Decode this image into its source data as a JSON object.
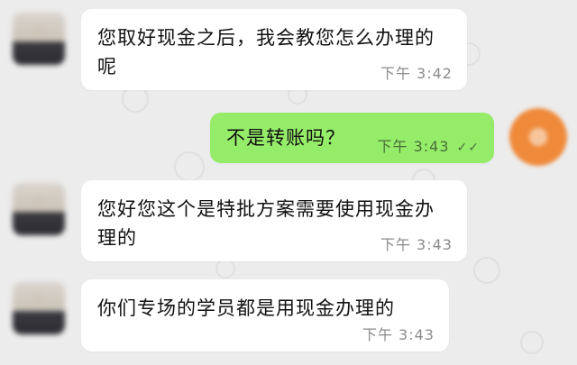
{
  "messages": [
    {
      "side": "left",
      "text": "您取好现金之后，我会教您怎么办理的呢",
      "time": "下午 3:42"
    },
    {
      "side": "right",
      "text": "不是转账吗？",
      "time": "下午 3:43",
      "status_icon": "double-check-icon"
    },
    {
      "side": "left",
      "text": "您好您这个是特批方案需要使用现金办理的",
      "time": "下午 3:43"
    },
    {
      "side": "left",
      "text": "你们专场的学员都是用现金办理的",
      "time": "下午 3:43"
    }
  ],
  "colors": {
    "background": "#ececec",
    "incoming_bubble": "#ffffff",
    "outgoing_bubble": "#95ec69"
  }
}
